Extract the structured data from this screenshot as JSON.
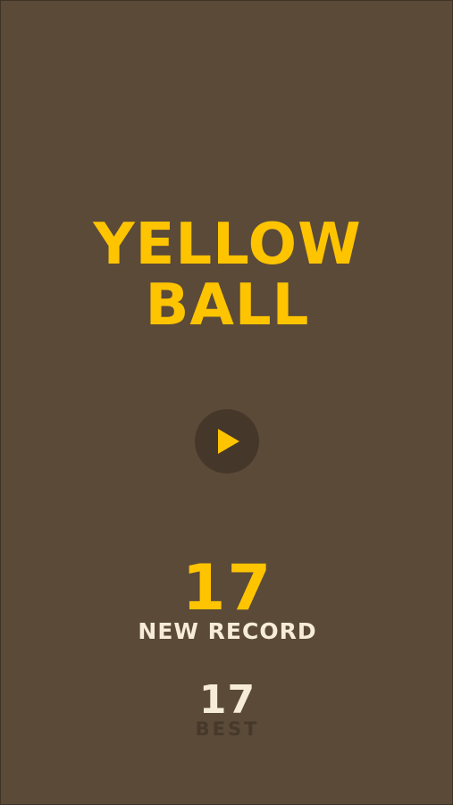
{
  "title": {
    "line1": "YELLOW",
    "line2": "BALL"
  },
  "play_button": {
    "icon": "play-icon"
  },
  "score": {
    "current": "17",
    "status": "NEW RECORD"
  },
  "best": {
    "value": "17",
    "label": "BEST"
  },
  "colors": {
    "background": "#5b4a38",
    "accent_yellow": "#ffc400",
    "light_text": "#f6ecd8",
    "dark_circle": "#45372a"
  }
}
